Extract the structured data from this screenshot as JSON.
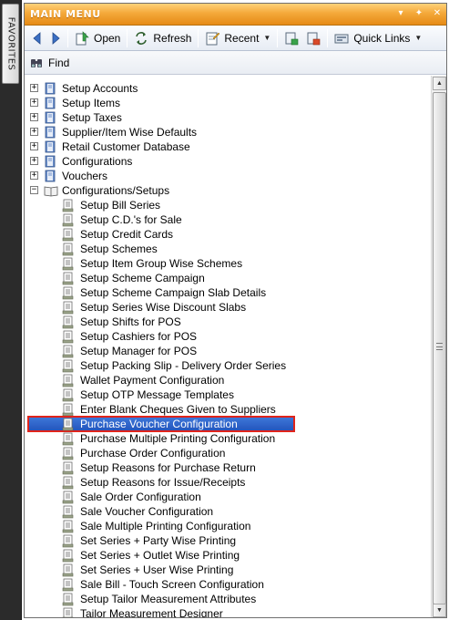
{
  "favorites": {
    "label": "FAVORITES"
  },
  "window": {
    "title": "MAIN MENU"
  },
  "toolbar": {
    "open_label": "Open",
    "refresh_label": "Refresh",
    "recent_label": "Recent",
    "quick_links_label": "Quick Links"
  },
  "find": {
    "label": "Find"
  },
  "tree": {
    "root_items": [
      {
        "label": "Setup Accounts",
        "expander": "+"
      },
      {
        "label": "Setup Items",
        "expander": "+"
      },
      {
        "label": "Setup Taxes",
        "expander": "+"
      },
      {
        "label": "Supplier/Item Wise Defaults",
        "expander": "+"
      },
      {
        "label": "Retail Customer Database",
        "expander": "+"
      },
      {
        "label": "Configurations",
        "expander": "+"
      },
      {
        "label": "Vouchers",
        "expander": "+"
      },
      {
        "label": "Configurations/Setups",
        "expander": "−"
      }
    ],
    "children": [
      "Setup Bill Series",
      "Setup C.D.'s for Sale",
      "Setup Credit Cards",
      "Setup Schemes",
      "Setup Item Group Wise Schemes",
      "Setup Scheme Campaign",
      "Setup Scheme Campaign Slab Details",
      "Setup Series Wise Discount Slabs",
      "Setup Shifts for POS",
      "Setup Cashiers for POS",
      "Setup Manager for POS",
      "Setup Packing Slip - Delivery Order Series",
      "Wallet Payment Configuration",
      "Setup OTP Message Templates",
      "Enter Blank Cheques Given to Suppliers",
      "Purchase Voucher Configuration",
      "Purchase Multiple Printing Configuration",
      "Purchase Order Configuration",
      "Setup Reasons for Purchase Return",
      "Setup Reasons for Issue/Receipts",
      "Sale Order Configuration",
      "Sale Voucher Configuration",
      "Sale Multiple Printing Configuration",
      "Set Series + Party Wise Printing",
      "Set Series + Outlet Wise Printing",
      "Set Series + User Wise Printing",
      "Sale Bill - Touch Screen Configuration",
      "Setup Tailor Measurement Attributes",
      "Tailor Measurement Designer"
    ],
    "selected_child": "Purchase Voucher Configuration"
  },
  "colors": {
    "title_bar": "#f4a93a",
    "selection": "#2f64c9",
    "selection_outline": "#e0241b"
  }
}
